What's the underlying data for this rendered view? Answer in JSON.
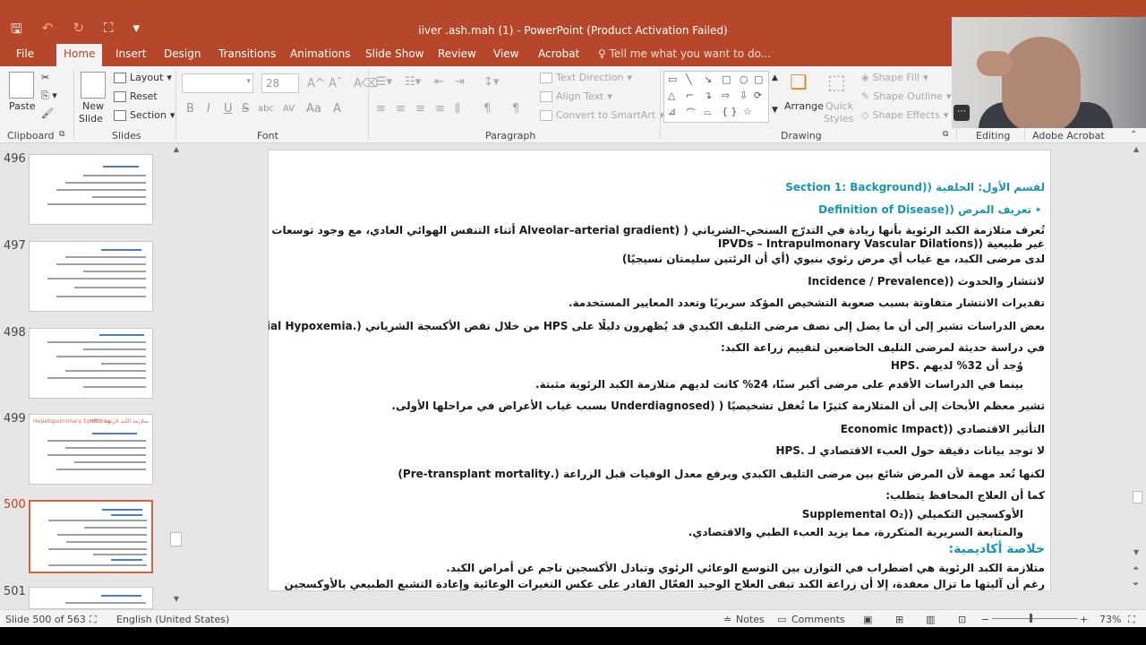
{
  "window": {
    "title": "iiver .ash.mah (1)  -  PowerPoint (Product Activation Failed)"
  },
  "qat": {
    "save_icon": "save-icon",
    "undo_icon": "undo-icon",
    "redo_icon": "redo-icon",
    "present_icon": "start-from-beginning-icon",
    "customize_icon": "customize-qat-icon"
  },
  "tabs": [
    {
      "label": "File"
    },
    {
      "label": "Home"
    },
    {
      "label": "Insert"
    },
    {
      "label": "Design"
    },
    {
      "label": "Transitions"
    },
    {
      "label": "Animations"
    },
    {
      "label": "Slide Show"
    },
    {
      "label": "Review"
    },
    {
      "label": "View"
    },
    {
      "label": "Acrobat"
    }
  ],
  "tell_me": "Tell me what you want to do...",
  "ribbon": {
    "clipboard": {
      "group": "Clipboard",
      "paste": "Paste"
    },
    "slides": {
      "group": "Slides",
      "new_slide": "New",
      "new_slide_2": "Slide",
      "layout": "Layout",
      "reset": "Reset",
      "section": "Section"
    },
    "font": {
      "group": "Font",
      "size": "28",
      "bold": "B",
      "italic": "I",
      "underline": "U",
      "strike": "S",
      "shadow": "abc",
      "spacing": "AV",
      "case": "Aa"
    },
    "paragraph": {
      "group": "Paragraph",
      "text_direction": "Text Direction",
      "align_text": "Align Text",
      "smartart": "Convert to SmartArt"
    },
    "drawing": {
      "group": "Drawing",
      "arrange": "Arrange",
      "quick_styles": "Quick",
      "quick_styles_2": "Styles",
      "shape_fill": "Shape Fill",
      "shape_outline": "Shape Outline",
      "shape_effects": "Shape Effects"
    },
    "editing": {
      "group": "Editing"
    },
    "acrobat": {
      "group": "Adobe Acrobat"
    }
  },
  "thumbnails": [
    {
      "num": "496"
    },
    {
      "num": "497"
    },
    {
      "num": "498"
    },
    {
      "num": "499",
      "title": "Hepatopulmonary Syndrome",
      "title_ar": "متلازمة الكبد الرئوية (HPS"
    },
    {
      "num": "500"
    },
    {
      "num": "501"
    }
  ],
  "slide": {
    "lines": [
      {
        "text": "لقسم الأول: الخلفية ((Section 1: Background",
        "style": "teal"
      },
      {
        "text": "🔹تعريف المرض ((Definition of Disease",
        "style": "teal"
      },
      {
        "text": "تُعرف متلازمة الكبد الرئوية بأنها زيادة في التدرّج السنخي–الشرياني ( (Alveolar–arterial gradient أثناء التنفس الهوائي العادي، مع وجود توسعات وعائية رئوية",
        "style": ""
      },
      {
        "text": "غير طبيعية ((IPVDs – Intrapulmonary Vascular Dilations",
        "style": ""
      },
      {
        "text": "لدى مرضى الكبد، مع غياب أي مرض رئوي بنيوي (أي أن الرئتين سليمتان نسيجيًا)",
        "style": ""
      },
      {
        "text": "لانتشار والحدوث ((Incidence / Prevalence",
        "style": ""
      },
      {
        "text": "تقديرات الانتشار متفاوتة بسبب صعوبة التشخيص المؤكد سريريًا وتعدد المعايير المستخدمة.",
        "style": ""
      },
      {
        "text": "بعض الدراسات تشير إلى أن ما يصل إلى نصف مرضى التليف الكبدي قد يُظهرون دليلًا على HPS من خلال نقص الأكسجة الشرياني (.Arterial Hypoxemia)",
        "style": ""
      },
      {
        "text": "في دراسة حديثة لمرضى التليف الخاضعين لتقييم زراعة الكبد:",
        "style": ""
      },
      {
        "text": "وُجد أن 32% لديهم .HPS",
        "style": "indent"
      },
      {
        "text": "بينما في الدراسات الأقدم على مرضى أكبر سنًا، 24% كانت لديهم متلازمة الكبد الرئوية مثبتة.",
        "style": "indent"
      },
      {
        "text": "تشير معظم الأبحاث إلى أن المتلازمة كثيرًا ما تُغفل تشخيصيًا ( (Underdiagnosed بسبب غياب الأعراض في مراحلها الأولى.",
        "style": ""
      },
      {
        "text": "التأثير الاقتصادي ((Economic Impact",
        "style": ""
      },
      {
        "text": "لا توجد بيانات دقيقة حول العبء الاقتصادي لـ .HPS",
        "style": ""
      },
      {
        "text": "لكنها تُعد مهمة لأن المرض شائع بين مرضى التليف الكبدي ويرفع معدل الوفيات قبل الزراعة (.Pre-transplant mortality)",
        "style": ""
      },
      {
        "text": "كما أن العلاج المحافظ يتطلب:",
        "style": ""
      },
      {
        "text": "الأوكسجين التكميلي ((Supplemental O₂",
        "style": "indent"
      },
      {
        "text": "والمتابعة السريرية المتكررة، مما يزيد العبء الطبي والاقتصادي.",
        "style": "indent"
      },
      {
        "text": "خلاصة أكاديمية:",
        "style": "teal-big"
      },
      {
        "text": "متلازمة الكبد الرئوية هي اضطراب في التوازن بين التوسع الوعائي الرئوي وتبادل الأكسجين ناجم عن أمراض الكبد.",
        "style": ""
      },
      {
        "text": "رغم أن آليتها ما تزال معقدة، إلا أن زراعة الكبد تبقى العلاج الوحيد الفعّال القادر على عكس التغيرات الوعائية وإعادة التشبع الطبيعي بالأوكسجين",
        "style": ""
      }
    ]
  },
  "statusbar": {
    "slide_count": "Slide 500 of 563",
    "language": "English (United States)",
    "notes": "Notes",
    "comments": "Comments",
    "zoom": "73%",
    "zoom_out": "−",
    "zoom_in": "+"
  },
  "colors": {
    "accent": "#b7472a",
    "teal": "#1795b8",
    "selected_thumb": "#d2613d"
  }
}
